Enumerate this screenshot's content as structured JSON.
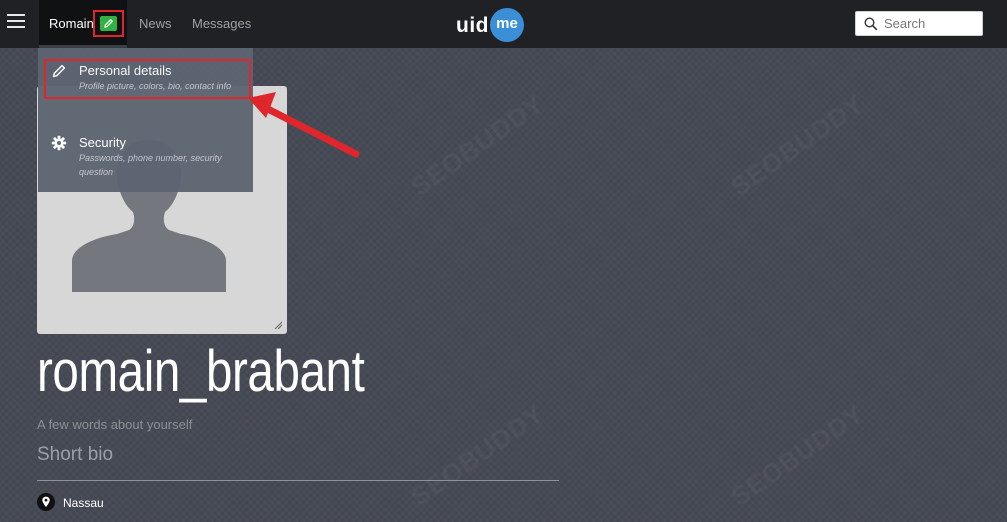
{
  "nav": {
    "user_label": "Romain",
    "news_label": "News",
    "messages_label": "Messages",
    "edit_icon": "pencil-icon",
    "menu_icon": "hamburger-menu-icon"
  },
  "logo": {
    "text": "uid",
    "badge": "me"
  },
  "search": {
    "placeholder": "Search",
    "value": ""
  },
  "dropdown": {
    "items": [
      {
        "title": "Personal details",
        "description": "Profile picture, colors, bio, contact info",
        "icon": "pencil-icon"
      },
      {
        "title": "Security",
        "description": "Passwords, phone number, security question",
        "icon": "gear-icon"
      }
    ]
  },
  "profile": {
    "username": "romain_brabant",
    "bio_label": "A few words about yourself",
    "bio_placeholder": "Short bio",
    "location": "Nassau"
  },
  "watermark": {
    "text": "SEOBUDDY"
  },
  "colors": {
    "topbar": "#1f2124",
    "background": "#464a54",
    "dropdown": "#5d6572",
    "edit_button": "#33b244",
    "logo_badge": "#3b8fd6",
    "annotation_red": "#e0262d"
  }
}
